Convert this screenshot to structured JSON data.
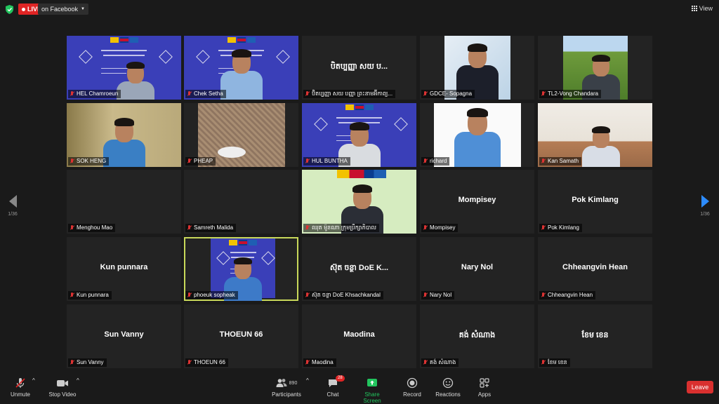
{
  "topbar": {
    "live_label": "LIVE",
    "destination_label": "on Facebook",
    "view_label": "View"
  },
  "navigation": {
    "left_page": "1/36",
    "right_page": "1/36"
  },
  "tiles": [
    {
      "name": "HEL Chamroeun",
      "video": true
    },
    {
      "name": "Chek Setha",
      "video": true
    },
    {
      "name": "ប៊ិតប្បញ្ញា សយ បញ្ញា ព្រះនាមអ៊ីកាព្យ...",
      "display": "បិតប្បញ្ញា សយ ប...",
      "video": false
    },
    {
      "name": "GDCE- Sopagna",
      "video": true
    },
    {
      "name": "TL2-Vong Chandara",
      "video": true
    },
    {
      "name": "SOK HENG",
      "video": true
    },
    {
      "name": "PHEAP",
      "video": true
    },
    {
      "name": "HUL BUNTHA",
      "video": true
    },
    {
      "name": "richard",
      "video": true
    },
    {
      "name": "Kan Samath",
      "video": true
    },
    {
      "name": "Menghou Mao",
      "display": "",
      "video": false
    },
    {
      "name": "Samreth Malida",
      "display": "",
      "video": false
    },
    {
      "name": "ឈុត ម៉ូនណា ក្រុមប្រឹក្សាភិបាល",
      "video": true
    },
    {
      "name": "Mompisey",
      "display": "Mompisey",
      "video": false
    },
    {
      "name": "Pok Kimlang",
      "display": "Pok Kimlang",
      "video": false
    },
    {
      "name": "Kun punnara",
      "display": "Kun punnara",
      "video": false
    },
    {
      "name": "phoeuk sopheak",
      "video": true,
      "active": true
    },
    {
      "name": "ស៊ុត ចន្ថា DoE Khsachkandal",
      "display": "ស៊ុត ចន្ថា DoE K...",
      "video": false
    },
    {
      "name": "Nary Nol",
      "display": "Nary Nol",
      "video": false
    },
    {
      "name": "Chheangvin Hean",
      "display": "Chheangvin Hean",
      "video": false
    },
    {
      "name": "Sun Vanny",
      "display": "Sun Vanny",
      "video": false
    },
    {
      "name": "THOEUN 66",
      "display": "THOEUN 66",
      "video": false
    },
    {
      "name": "Maodina",
      "display": "Maodina",
      "video": false
    },
    {
      "name": "គង់ សំណាង",
      "display": "គង់ សំណាង",
      "video": false
    },
    {
      "name": "ខែម ខេន",
      "display": "ខែម ខេន",
      "video": false
    }
  ],
  "toolbar": {
    "unmute": "Unmute",
    "stop_video": "Stop Video",
    "participants": "Participants",
    "participant_count": "890",
    "chat": "Chat",
    "chat_badge": "28",
    "share_screen": "Share Screen",
    "record": "Record",
    "reactions": "Reactions",
    "apps": "Apps",
    "leave": "Leave"
  },
  "colors": {
    "accent_green": "#22c55e",
    "leave_red": "#d9302f",
    "live_red": "#e02424",
    "active_outline": "#c8d85a",
    "nav_blue": "#2d8cff"
  }
}
